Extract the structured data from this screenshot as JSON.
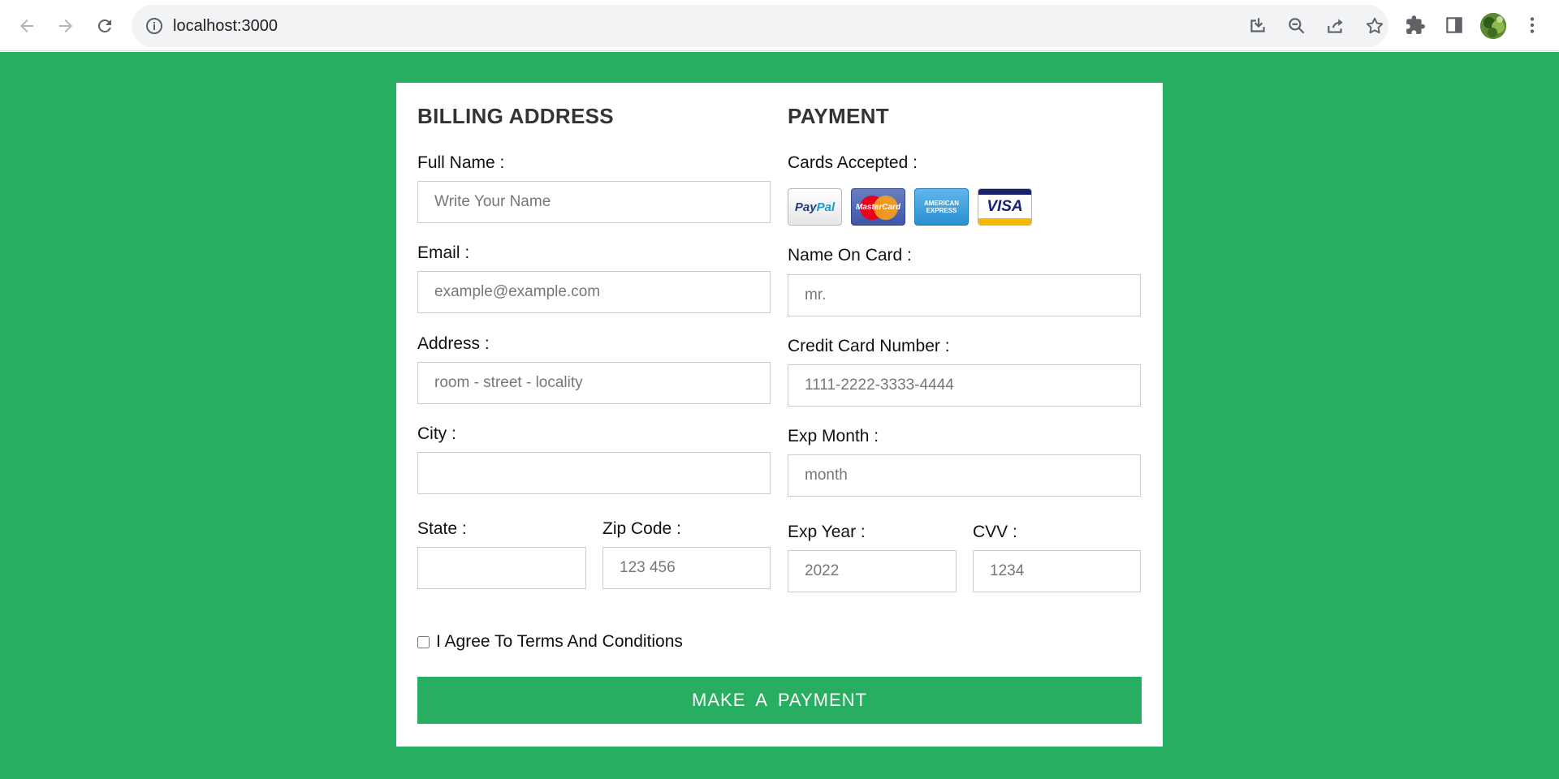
{
  "browser": {
    "url": "localhost:3000"
  },
  "billing": {
    "heading": "BILLING ADDRESS",
    "full_name_label": "Full Name :",
    "full_name_placeholder": "Write Your Name",
    "email_label": "Email :",
    "email_placeholder": "example@example.com",
    "address_label": "Address :",
    "address_placeholder": "room - street - locality",
    "city_label": "City :",
    "city_placeholder": "",
    "state_label": "State :",
    "state_placeholder": "",
    "zip_label": "Zip Code :",
    "zip_placeholder": "123 456"
  },
  "payment": {
    "heading": "PAYMENT",
    "cards_label": "Cards Accepted :",
    "cards": [
      {
        "name": "PayPal",
        "icon": "paypal-icon"
      },
      {
        "name": "MasterCard",
        "icon": "mastercard-icon"
      },
      {
        "name": "AMERICAN EXPRESS",
        "icon": "amex-icon"
      },
      {
        "name": "VISA",
        "icon": "visa-icon"
      }
    ],
    "name_on_card_label": "Name On Card :",
    "name_on_card_placeholder": "mr.",
    "card_number_label": "Credit Card Number :",
    "card_number_placeholder": "1111-2222-3333-4444",
    "exp_month_label": "Exp Month :",
    "exp_month_placeholder": "month",
    "exp_year_label": "Exp Year :",
    "exp_year_placeholder": "2022",
    "cvv_label": "CVV :",
    "cvv_placeholder": "1234"
  },
  "terms": {
    "label": "I Agree To Terms And Conditions",
    "checked": false
  },
  "submit_label": "MAKE  A  PAYMENT",
  "colors": {
    "background": "#27ae60",
    "button": "#27ae60"
  }
}
